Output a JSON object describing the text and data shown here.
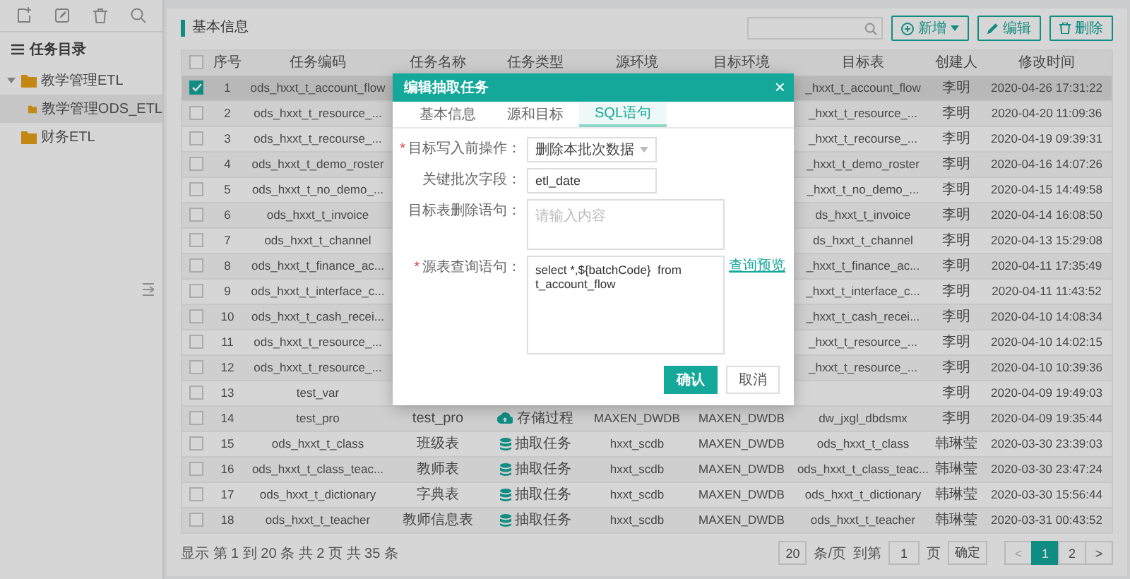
{
  "sidebar": {
    "title": "任务目录",
    "tree": [
      {
        "label": "教学管理ETL",
        "expanded": true,
        "selected": false,
        "children": [
          {
            "label": "教学管理ODS_ETL",
            "selected": true
          }
        ]
      },
      {
        "label": "财务ETL",
        "selected": false
      }
    ]
  },
  "panel": {
    "title": "基本信息",
    "buttons": [
      {
        "label": "新增",
        "kind": "add"
      },
      {
        "label": "编辑",
        "kind": "edit"
      },
      {
        "label": "删除",
        "kind": "delete"
      }
    ]
  },
  "table": {
    "all_checked": false,
    "columns": [
      "序号",
      "任务编码",
      "任务名称",
      "任务类型",
      "源环境",
      "目标环境",
      "目标表",
      "创建人",
      "修改时间"
    ],
    "rows": [
      {
        "selected": true,
        "checked": true,
        "no": "1",
        "code": "ods_hxxt_t_account_flow",
        "table": "_hxxt_t_account_flow",
        "creator": "李明",
        "modified": "2020-04-26 17:31:22"
      },
      {
        "selected": false,
        "checked": false,
        "no": "2",
        "code": "ods_hxxt_t_resource_...",
        "table": "_hxxt_t_resource_...",
        "creator": "李明",
        "modified": "2020-04-20 11:09:36"
      },
      {
        "selected": false,
        "checked": false,
        "no": "3",
        "code": "ods_hxxt_t_recourse_...",
        "table": "_hxxt_t_recourse_...",
        "creator": "李明",
        "modified": "2020-04-19 09:39:31"
      },
      {
        "selected": false,
        "checked": false,
        "no": "4",
        "code": "ods_hxxt_t_demo_roster",
        "table": "_hxxt_t_demo_roster",
        "creator": "李明",
        "modified": "2020-04-16 14:07:26"
      },
      {
        "selected": false,
        "checked": false,
        "no": "5",
        "code": "ods_hxxt_t_no_demo_...",
        "table": "_hxxt_t_no_demo_...",
        "creator": "李明",
        "modified": "2020-04-15 14:49:58"
      },
      {
        "selected": false,
        "checked": false,
        "no": "6",
        "code": "ods_hxxt_t_invoice",
        "table": "ds_hxxt_t_invoice",
        "creator": "李明",
        "modified": "2020-04-14 16:08:50"
      },
      {
        "selected": false,
        "checked": false,
        "no": "7",
        "code": "ods_hxxt_t_channel",
        "table": "ds_hxxt_t_channel",
        "creator": "李明",
        "modified": "2020-04-13 15:29:08"
      },
      {
        "selected": false,
        "checked": false,
        "no": "8",
        "code": "ods_hxxt_t_finance_ac...",
        "table": "_hxxt_t_finance_ac...",
        "creator": "李明",
        "modified": "2020-04-11 17:35:49"
      },
      {
        "selected": false,
        "checked": false,
        "no": "9",
        "code": "ods_hxxt_t_interface_c...",
        "table": "_hxxt_t_interface_c...",
        "creator": "李明",
        "modified": "2020-04-11 11:43:52"
      },
      {
        "selected": false,
        "checked": false,
        "no": "10",
        "code": "ods_hxxt_t_cash_recei...",
        "table": "_hxxt_t_cash_recei...",
        "creator": "李明",
        "modified": "2020-04-10 14:08:34"
      },
      {
        "selected": false,
        "checked": false,
        "no": "11",
        "code": "ods_hxxt_t_resource_...",
        "table": "_hxxt_t_resource_...",
        "creator": "李明",
        "modified": "2020-04-10 14:02:15"
      },
      {
        "selected": false,
        "checked": false,
        "no": "12",
        "code": "ods_hxxt_t_resource_...",
        "table": "_hxxt_t_resource_...",
        "creator": "李明",
        "modified": "2020-04-10 10:39:36"
      },
      {
        "selected": false,
        "checked": false,
        "no": "13",
        "code": "test_var",
        "creator": "李明",
        "modified": "2020-04-09 19:49:03"
      },
      {
        "selected": false,
        "checked": false,
        "no": "14",
        "code": "test_pro",
        "name": "test_pro",
        "type": {
          "label": "存储过程",
          "kind": "procedure"
        },
        "source": "MAXEN_DWDB",
        "target": "MAXEN_DWDB",
        "table": "dw_jxgl_dbdsmx",
        "creator": "李明",
        "modified": "2020-04-09 19:35:44"
      },
      {
        "selected": false,
        "checked": false,
        "no": "15",
        "code": "ods_hxxt_t_class",
        "name": "班级表",
        "type": {
          "label": "抽取任务",
          "kind": "extract"
        },
        "source": "hxxt_scdb",
        "target": "MAXEN_DWDB",
        "table": "ods_hxxt_t_class",
        "creator": "韩琳莹",
        "modified": "2020-03-30 23:39:03"
      },
      {
        "selected": false,
        "checked": false,
        "no": "16",
        "code": "ods_hxxt_t_class_teac...",
        "name": "教师表",
        "type": {
          "label": "抽取任务",
          "kind": "extract"
        },
        "source": "hxxt_scdb",
        "target": "MAXEN_DWDB",
        "table": "ods_hxxt_t_class_teac...",
        "creator": "韩琳莹",
        "modified": "2020-03-30 23:47:24"
      },
      {
        "selected": false,
        "checked": false,
        "no": "17",
        "code": "ods_hxxt_t_dictionary",
        "name": "字典表",
        "type": {
          "label": "抽取任务",
          "kind": "extract"
        },
        "source": "hxxt_scdb",
        "target": "MAXEN_DWDB",
        "table": "ods_hxxt_t_dictionary",
        "creator": "韩琳莹",
        "modified": "2020-03-30 15:56:44"
      },
      {
        "selected": false,
        "checked": false,
        "no": "18",
        "code": "ods_hxxt_t_teacher",
        "name": "教师信息表",
        "type": {
          "label": "抽取任务",
          "kind": "extract"
        },
        "source": "hxxt_scdb",
        "target": "MAXEN_DWDB",
        "table": "ods_hxxt_t_teacher",
        "creator": "韩琳莹",
        "modified": "2020-03-31 00:43:52"
      }
    ]
  },
  "footer": {
    "summary": "显示 第 1 到 20 条 共 2 页 共 35 条",
    "page_size": "20",
    "page_size_unit": "条/页",
    "goto_label": "到第",
    "goto_value": "1",
    "goto_unit": "页",
    "goto_button": "确定",
    "prev": "<",
    "next": ">",
    "pages": [
      {
        "label": "1",
        "selected": true
      },
      {
        "label": "2",
        "selected": false
      }
    ]
  },
  "dialog": {
    "title": "编辑抽取任务",
    "close": "×",
    "tabs": [
      {
        "label": "基本信息",
        "selected": false
      },
      {
        "label": "源和目标",
        "selected": false
      },
      {
        "label": "SQL语句",
        "selected": true
      }
    ],
    "fields": [
      {
        "kind": "select",
        "required_mark": "*",
        "label": "目标写入前操作：",
        "value": "删除本批次数据"
      },
      {
        "kind": "input",
        "label": "关键批次字段：",
        "value": "etl_date"
      },
      {
        "kind": "textarea",
        "label": "目标表删除语句：",
        "placeholder": "请输入内容"
      },
      {
        "kind": "textarea",
        "required_mark": "*",
        "label": "源表查询语句：",
        "value": "select *,${batchCode}  from t_account_flow",
        "link": "查询预览"
      }
    ],
    "buttons": [
      {
        "label": "确认",
        "kind": "primary"
      },
      {
        "label": "取消",
        "kind": "default"
      }
    ]
  }
}
